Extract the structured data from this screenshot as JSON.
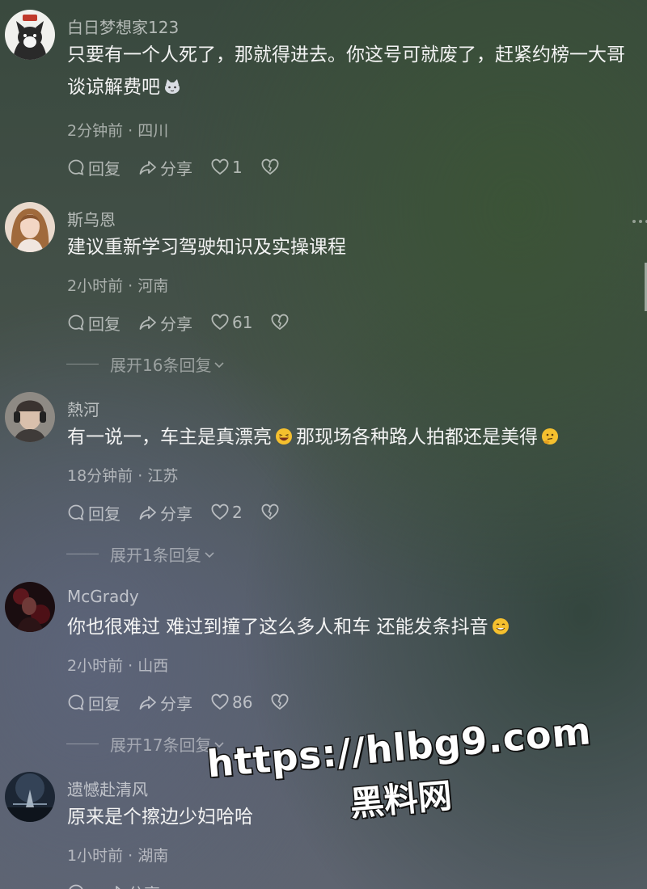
{
  "comments": [
    {
      "username": "白日梦想家123",
      "text": "只要有一个人死了，那就得进去。你这号可就废了，赶紧约榜一大哥谈谅解费吧",
      "time": "2分钟前",
      "location": "四川",
      "reply_label": "回复",
      "share_label": "分享",
      "likes": "1",
      "avatar_icon": "cat-avatar-icon"
    },
    {
      "username": "斯乌恩",
      "text": "建议重新学习驾驶知识及实操课程",
      "time": "2小时前",
      "location": "河南",
      "reply_label": "回复",
      "share_label": "分享",
      "likes": "61",
      "expand_label": "展开16条回复",
      "avatar_icon": "woman-avatar-icon"
    },
    {
      "username": "熱河",
      "text_a": "有一说一，车主是真漂亮",
      "text_b": "那现场各种路人拍都还是美得",
      "time": "18分钟前",
      "location": "江苏",
      "reply_label": "回复",
      "share_label": "分享",
      "likes": "2",
      "expand_label": "展开1条回复",
      "avatar_icon": "headphones-avatar-icon"
    },
    {
      "username": "McGrady",
      "text": "你也很难过 难过到撞了这么多人和车 还能发条抖音",
      "time": "2小时前",
      "location": "山西",
      "reply_label": "回复",
      "share_label": "分享",
      "likes": "86",
      "expand_label": "展开17条回复",
      "avatar_icon": "dark-red-avatar-icon"
    },
    {
      "username": "遗憾赴清风",
      "text": "原来是个擦边少妇哈哈",
      "time": "1小时前",
      "location": "湖南",
      "share_label": "分享",
      "avatar_icon": "night-sky-avatar-icon"
    }
  ],
  "separator": " · ",
  "watermark": {
    "url": "https://hlbg9.com",
    "name": "黑料网"
  },
  "colors": {
    "text": "#f3f3f3",
    "muted": "#9aa19b"
  }
}
